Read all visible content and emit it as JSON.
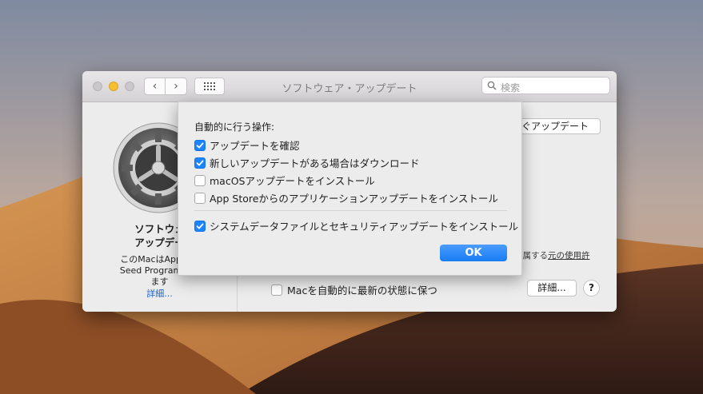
{
  "window": {
    "title": "ソフトウェア・アップデート",
    "search_placeholder": "検索"
  },
  "sidebar": {
    "title_line1": "ソフトウェ",
    "title_line2": "アップデー",
    "desc_line1": "このMacはApple D",
    "desc_line2": "Seed Programに登",
    "desc_line3": "ます",
    "details_link": "詳細..."
  },
  "main": {
    "update_now_button": "ぐアップデート",
    "license_prefix": "付属する",
    "license_link": "元の使用許",
    "auto_update_label": "Macを自動的に最新の状態に保つ",
    "auto_update_checked": false,
    "advanced_button": "詳細...",
    "help_button": "?"
  },
  "sheet": {
    "heading": "自動的に行う操作:",
    "options": [
      {
        "label": "アップデートを確認",
        "checked": true
      },
      {
        "label": "新しいアップデートがある場合はダウンロード",
        "checked": true
      },
      {
        "label": "macOSアップデートをインストール",
        "checked": false
      },
      {
        "label": "App Storeからのアプリケーションアップデートをインストール",
        "checked": false
      },
      {
        "label": "システムデータファイルとセキュリティアップデートをインストール",
        "checked": true
      }
    ],
    "ok_button": "OK"
  },
  "colors": {
    "accent": "#1b84ff",
    "minimize": "#f6be33",
    "link": "#1a63c8"
  }
}
